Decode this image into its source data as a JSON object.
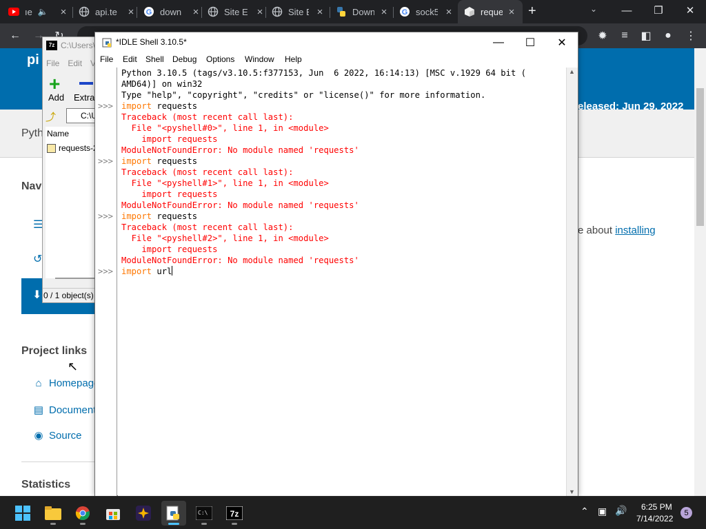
{
  "browser": {
    "tabs": [
      {
        "title": "ıe",
        "icon": "youtube-icon",
        "extra_icon": "speaker-icon"
      },
      {
        "title": "api.te",
        "icon": "globe-icon"
      },
      {
        "title": "down",
        "icon": "google-icon"
      },
      {
        "title": "Site E",
        "icon": "globe-icon"
      },
      {
        "title": "Site E",
        "icon": "globe-icon"
      },
      {
        "title": "Down",
        "icon": "python-icon"
      },
      {
        "title": "sock5",
        "icon": "google-icon"
      },
      {
        "title": "reque",
        "icon": "pypi-cube-icon",
        "active": true
      }
    ],
    "new_tab": "+",
    "window_controls": {
      "minimize": "—",
      "restore": "❐",
      "close": "✕"
    }
  },
  "pypi": {
    "logo_partial": "pi",
    "released": "eleased: Jun 29, 2022",
    "subbar_text": "Pyth",
    "nav_heading": "Nav",
    "download_text": "⬇",
    "about_prefix": "e about ",
    "about_link": "installing",
    "project_links_heading": "Project links",
    "project_links": [
      {
        "label": "Homepage",
        "icon": "home-icon"
      },
      {
        "label": "Document",
        "icon": "book-icon"
      },
      {
        "label": "Source",
        "icon": "github-icon"
      }
    ],
    "statistics_heading": "Statistics"
  },
  "sevenzip": {
    "title": "C:\\Users\\",
    "logo": "7z",
    "menu": [
      "File",
      "Edit",
      "V"
    ],
    "toolbar": {
      "add": "Add",
      "extract": "Extrac"
    },
    "address": "C:\\U",
    "column_name": "Name",
    "row": "requests-2",
    "status": "0 / 1 object(s)"
  },
  "idle": {
    "title": "*IDLE Shell 3.10.5*",
    "window_controls": {
      "minimize": "—",
      "maximize": "☐",
      "close": "✕"
    },
    "menu": [
      "File",
      "Edit",
      "Shell",
      "Debug",
      "Options",
      "Window",
      "Help"
    ],
    "banner": [
      "Python 3.10.5 (tags/v3.10.5:f377153, Jun  6 2022, 16:14:13) [MSC v.1929 64 bit (",
      "AMD64)] on win32",
      "Type \"help\", \"copyright\", \"credits\" or \"license()\" for more information."
    ],
    "prompt": ">>>",
    "keyword": "import",
    "module": " requests",
    "traceback_header": "Traceback (most recent call last):",
    "file_lines": [
      "  File \"<pyshell#0>\", line 1, in <module>",
      "  File \"<pyshell#1>\", line 1, in <module>",
      "  File \"<pyshell#2>\", line 1, in <module>"
    ],
    "source_line": "    import requests",
    "error_line": "ModuleNotFoundError: No module named 'requests'",
    "current_input": " url"
  },
  "taskbar": {
    "apps": [
      "windows-start-icon",
      "file-explorer-icon",
      "chrome-icon",
      "store-icon",
      "spark-app-icon",
      "idle-python-icon",
      "terminal-icon",
      "sevenzip-icon"
    ],
    "time": "6:25 PM",
    "date": "7/14/2022",
    "notifications": "5"
  }
}
